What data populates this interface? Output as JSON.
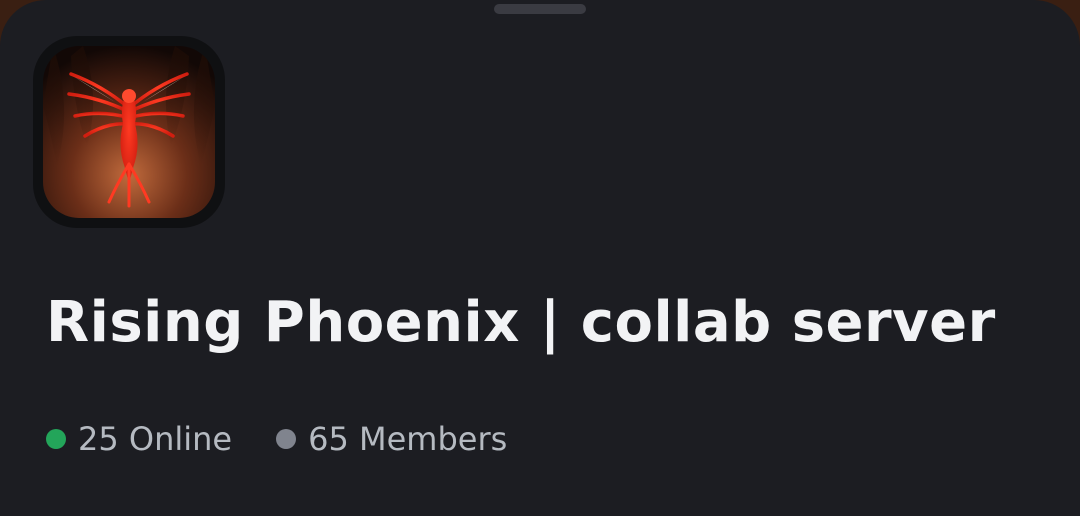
{
  "server": {
    "name": "Rising Phoenix | collab server",
    "icon": "phoenix-logo"
  },
  "stats": {
    "online_label": "25 Online",
    "members_label": "65 Members"
  },
  "colors": {
    "sheet_background": "#1c1d22",
    "title_text": "#f2f3f5",
    "muted_text": "#b5bac1",
    "online_dot": "#23a55a",
    "members_dot": "#80848e",
    "handle": "#3a3b42"
  }
}
